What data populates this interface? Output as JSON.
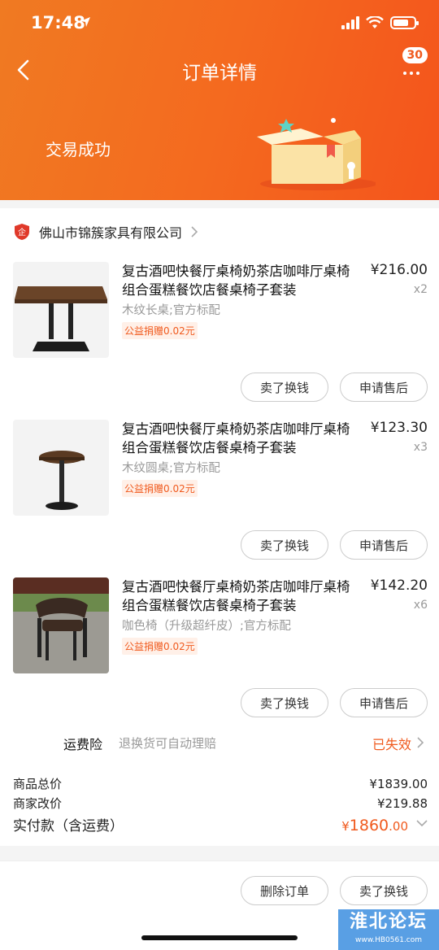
{
  "status_bar": {
    "time": "17:48"
  },
  "header": {
    "title": "订单详情",
    "message_count": "30",
    "order_status": "交易成功"
  },
  "shop": {
    "name": "佛山市锦簇家具有限公司"
  },
  "items": [
    {
      "name": "复古酒吧快餐厅桌椅奶茶店咖啡厅桌椅组合蛋糕餐饮店餐桌椅子套装",
      "price": "¥216.00",
      "qty": "x2",
      "spec": "木纹长桌;官方标配",
      "charity": "公益捐赠0.02元",
      "sell_label": "卖了换钱",
      "aftersale_label": "申请售后",
      "image": "rectangular-wood-table"
    },
    {
      "name": "复古酒吧快餐厅桌椅奶茶店咖啡厅桌椅组合蛋糕餐饮店餐桌椅子套装",
      "price": "¥123.30",
      "qty": "x3",
      "spec": "木纹圆桌;官方标配",
      "charity": "公益捐赠0.02元",
      "sell_label": "卖了换钱",
      "aftersale_label": "申请售后",
      "image": "round-wood-table"
    },
    {
      "name": "复古酒吧快餐厅桌椅奶茶店咖啡厅桌椅组合蛋糕餐饮店餐桌椅子套装",
      "price": "¥142.20",
      "qty": "x6",
      "spec": "咖色椅（升级超纤皮）;官方标配",
      "charity": "公益捐赠0.02元",
      "sell_label": "卖了换钱",
      "aftersale_label": "申请售后",
      "image": "brown-leather-chair"
    }
  ],
  "insurance": {
    "label": "运费险",
    "desc": "退换货可自动理赔",
    "status": "已失效"
  },
  "summary": {
    "goods_total_label": "商品总价",
    "goods_total": "¥1839.00",
    "adjust_label": "商家改价",
    "adjust": "¥219.88",
    "paid_label": "实付款（含运费）",
    "paid_symbol": "¥",
    "paid_int": "1860",
    "paid_dec": ".00"
  },
  "bottom": {
    "delete_label": "删除订单",
    "sell_label": "卖了换钱"
  },
  "watermark": {
    "main": "淮北论坛",
    "sub": "www.HB0561.com"
  },
  "colors": {
    "accent": "#f05a1e",
    "header_start": "#f07a22",
    "header_end": "#f4541c"
  }
}
